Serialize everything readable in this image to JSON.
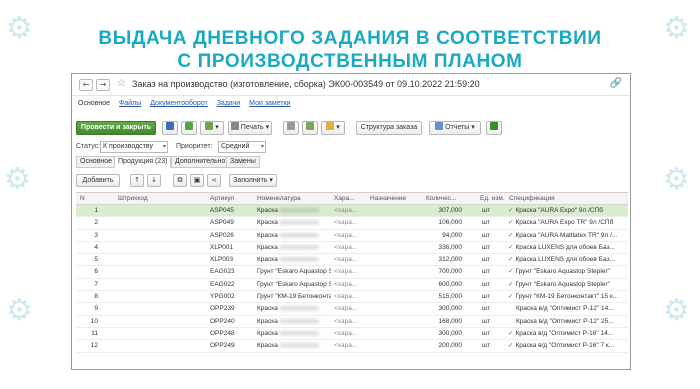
{
  "slide": {
    "title_line1": "ВЫДАЧА ДНЕВНОГО ЗАДАНИЯ В СООТВЕТСТВИИ",
    "title_line2": "С ПРОИЗВОДСТВЕННЫМ ПЛАНОМ",
    "accent_color": "#19a9c4"
  },
  "window": {
    "title": "Заказ на производство (изготовление, сборка) ЭК00-003549 от 09.10.2022 21:59:20",
    "nav": {
      "back": "←",
      "forward": "→"
    }
  },
  "top_tabs": [
    {
      "label": "Основное",
      "active": true
    },
    {
      "label": "Файлы",
      "active": false
    },
    {
      "label": "Документооборот",
      "active": false
    },
    {
      "label": "Задачи",
      "active": false
    },
    {
      "label": "Мои заметки",
      "active": false
    }
  ],
  "toolbar": {
    "post_close": "Провести и закрыть",
    "print": "Печать",
    "order_structure": "Структура заказа",
    "reports": "Отчеты"
  },
  "status": {
    "label": "Статус:",
    "value": "К производству"
  },
  "priority": {
    "label": "Приоритет:",
    "value": "Средний"
  },
  "mid_tabs": [
    {
      "label": "Основное",
      "active": false
    },
    {
      "label": "Продукция (23)",
      "active": true
    },
    {
      "label": "Дополнительно",
      "active": false
    },
    {
      "label": "Замены",
      "active": false
    }
  ],
  "grid_toolbar": {
    "add": "Добавить",
    "fill": "Заполнить"
  },
  "table": {
    "columns": [
      "N",
      "Штрихкод",
      "Артикул",
      "Номенклатура",
      "Хара...",
      "Назначение",
      "Количес...",
      "Ед. изм.",
      "Спецификация"
    ],
    "rows": [
      {
        "n": "1",
        "art": "ASP045",
        "nom": "Краска",
        "char": "<хара...",
        "qty": "307,000",
        "unit": "шт",
        "check": true,
        "spec": "Краска \"AURA Expo\" 9л /СПб"
      },
      {
        "n": "2",
        "art": "ASP049",
        "nom": "Краска",
        "char": "<хара...",
        "qty": "106,000",
        "unit": "шт",
        "check": true,
        "spec": "Краска \"AURA Expo TR\" 9л /СПб"
      },
      {
        "n": "3",
        "art": "ASP026",
        "nom": "Краска",
        "char": "<хара...",
        "qty": "94,000",
        "unit": "шт",
        "check": true,
        "spec": "Краска \"AURA Mattlatex TR\" 9л /..."
      },
      {
        "n": "4",
        "art": "XLP001",
        "nom": "Краска",
        "char": "<хара...",
        "qty": "336,000",
        "unit": "шт",
        "check": true,
        "spec": "Краска LUXENS для обоев Баз..."
      },
      {
        "n": "5",
        "art": "XLP003",
        "nom": "Краска",
        "char": "<хара...",
        "qty": "312,000",
        "unit": "шт",
        "check": true,
        "spec": "Краска LUXENS для обоев Баз..."
      },
      {
        "n": "6",
        "art": "EAG023",
        "nom": "Грунт \"Eskaro Aquastop Stepler\"",
        "char": "<хара...",
        "qty": "700,000",
        "unit": "шт",
        "check": true,
        "spec": "Грунт \"Eskaro Aquastop Stepler\""
      },
      {
        "n": "7",
        "art": "EAG022",
        "nom": "Грунт \"Eskaro Aquastop Stepler\"",
        "char": "<хара...",
        "qty": "600,000",
        "unit": "шт",
        "check": true,
        "spec": "Грунт \"Eskaro Aquastop Stepler\""
      },
      {
        "n": "8",
        "art": "YPG002",
        "nom": "Грунт \"КМ-19 Бетонконтакт\"",
        "char": "<хара...",
        "qty": "515,000",
        "unit": "шт",
        "check": true,
        "spec": "Грунт \"КМ-19 Бетонконтакт\" 15 к..."
      },
      {
        "n": "9",
        "art": "OPP239",
        "nom": "Краска",
        "char": "<хара...",
        "qty": "300,000",
        "unit": "шт",
        "check": false,
        "spec": "Краска в/д \"Оптимист Р-12\" 14..."
      },
      {
        "n": "10",
        "art": "OPP240",
        "nom": "Краска",
        "char": "<хара...",
        "qty": "168,000",
        "unit": "шт",
        "check": false,
        "spec": "Краска в/д \"Оптимист Р-12\" 25..."
      },
      {
        "n": "11",
        "art": "OPP248",
        "nom": "Краска",
        "char": "<хара...",
        "qty": "300,000",
        "unit": "шт",
        "check": true,
        "spec": "Краска в/д \"Оптимист Р-16\" 14..."
      },
      {
        "n": "12",
        "art": "OPP249",
        "nom": "Краска",
        "char": "<хара...",
        "qty": "200,000",
        "unit": "шт",
        "check": true,
        "spec": "Краска в/д \"Оптимист Р-16\" 7 к..."
      }
    ]
  }
}
